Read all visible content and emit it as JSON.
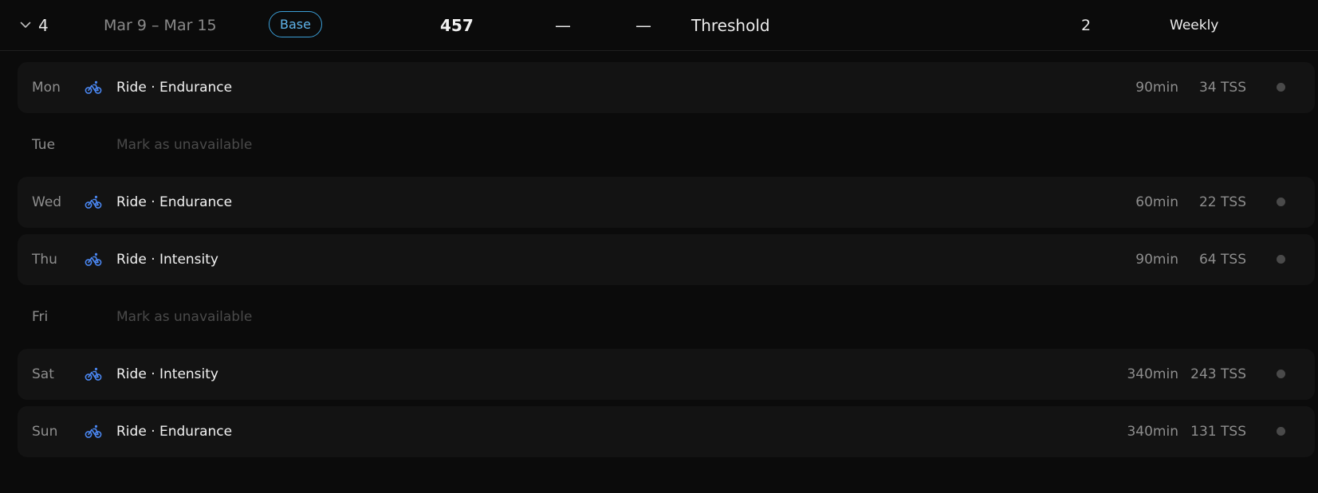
{
  "week": {
    "number": "4",
    "date_range": "Mar 9 – Mar 15",
    "phase": "Base",
    "tss_total": "457",
    "col_a": "—",
    "col_b": "—",
    "focus": "Threshold",
    "count": "2",
    "frequency": "Weekly"
  },
  "icons": {
    "expand": "chevron-down-icon",
    "workout": "bike-icon",
    "status": "status-dot-icon"
  },
  "colors": {
    "background": "#0b0b0b",
    "row_background": "#131313",
    "accent_blue": "#4a86f0",
    "badge_blue": "#3b9ed6",
    "status_dot": "#4a4a4a"
  },
  "days": [
    {
      "day": "Mon",
      "workout": "Ride · Endurance",
      "duration": "90min",
      "tss": "34 TSS"
    },
    {
      "day": "Tue",
      "unavailable": "Mark as unavailable"
    },
    {
      "day": "Wed",
      "workout": "Ride · Endurance",
      "duration": "60min",
      "tss": "22 TSS"
    },
    {
      "day": "Thu",
      "workout": "Ride · Intensity",
      "duration": "90min",
      "tss": "64 TSS"
    },
    {
      "day": "Fri",
      "unavailable": "Mark as unavailable"
    },
    {
      "day": "Sat",
      "workout": "Ride · Intensity",
      "duration": "340min",
      "tss": "243 TSS"
    },
    {
      "day": "Sun",
      "workout": "Ride · Endurance",
      "duration": "340min",
      "tss": "131 TSS"
    }
  ]
}
